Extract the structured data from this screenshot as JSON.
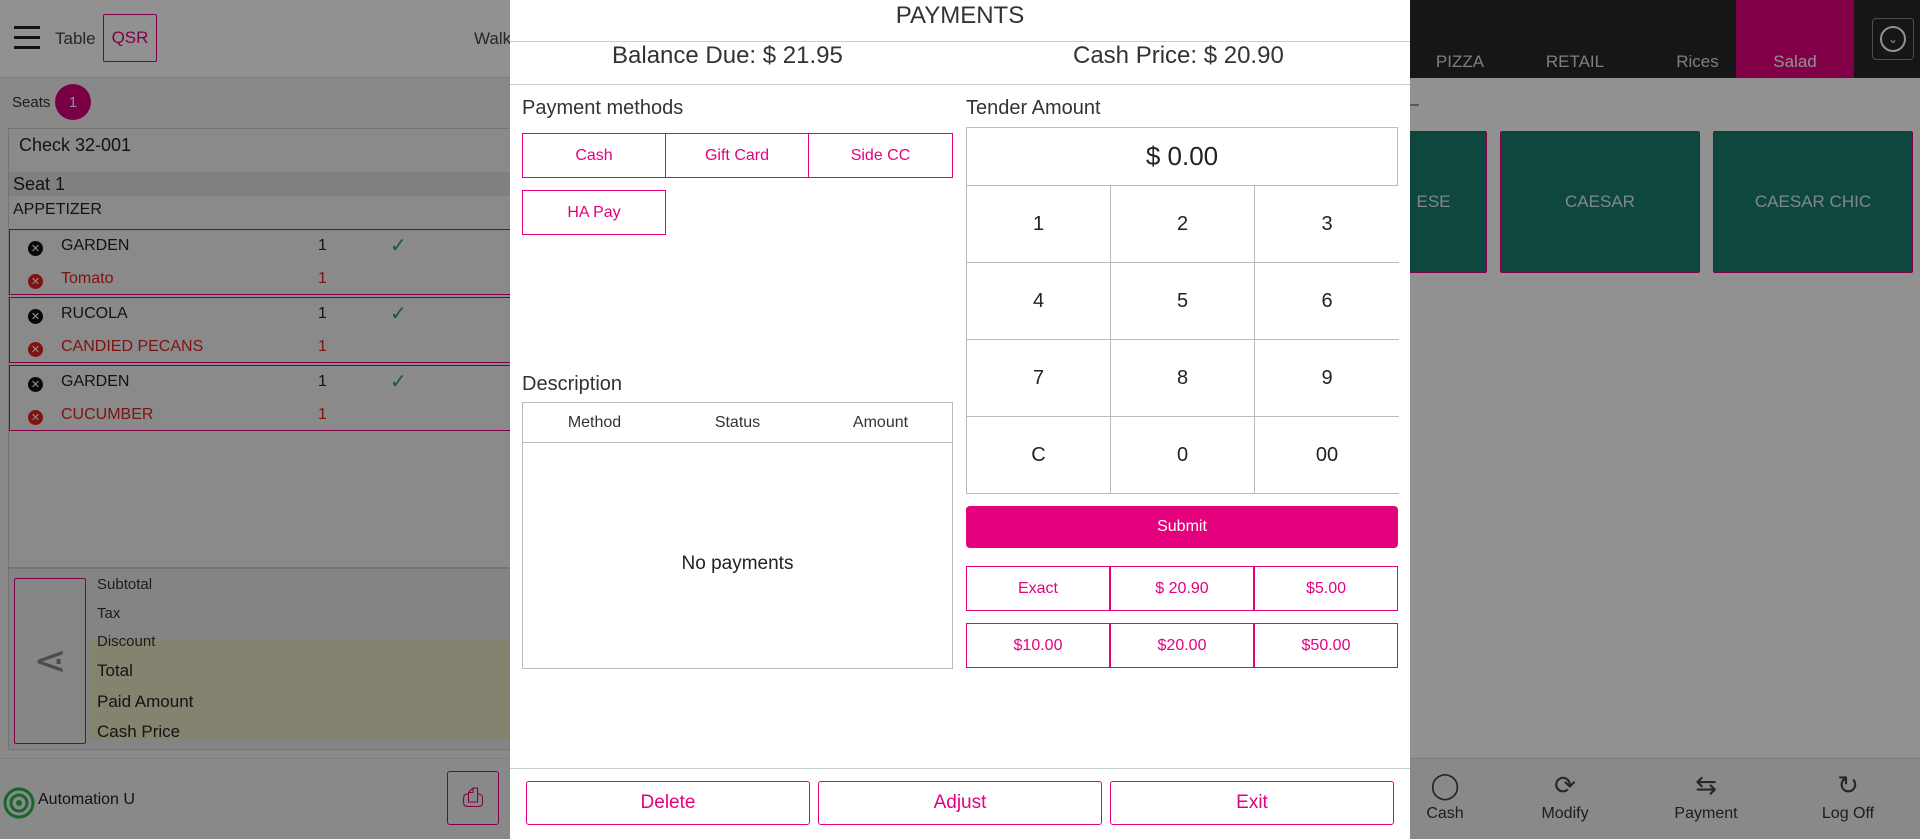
{
  "header": {
    "table_label": "Table",
    "mode_button": "QSR",
    "walk_label": "Walk"
  },
  "categories": {
    "items": [
      {
        "label": "PIZZA"
      },
      {
        "label": "RETAIL"
      },
      {
        "label": "Rices"
      },
      {
        "label": "Salad"
      }
    ],
    "active": "Salad"
  },
  "seats": {
    "label": "Seats",
    "count": "1"
  },
  "check": {
    "title": "Check 32-001",
    "seat_label": "Seat 1",
    "group_label": "APPETIZER",
    "items": [
      {
        "name": "GARDEN",
        "qty": "1",
        "modifier": "Tomato",
        "modifier_qty": "1"
      },
      {
        "name": "RUCOLA",
        "qty": "1",
        "modifier": "CANDIED PECANS",
        "modifier_qty": "1"
      },
      {
        "name": "GARDEN",
        "qty": "1",
        "modifier": "CUCUMBER",
        "modifier_qty": "1"
      }
    ]
  },
  "totals": {
    "subtotal": "Subtotal",
    "tax": "Tax",
    "discount": "Discount",
    "total": "Total",
    "paid": "Paid Amount",
    "cash_price": "Cash Price"
  },
  "menu_tiles": [
    "ESE",
    "CAESAR",
    "CAESAR CHIC"
  ],
  "footer": {
    "user": "Automation U",
    "actions": [
      "Cash",
      "Modify",
      "Payment",
      "Log Off"
    ]
  },
  "modal": {
    "title": "PAYMENTS",
    "balance_due": "Balance Due: $ 21.95",
    "cash_price": "Cash Price: $ 20.90",
    "payment_methods_label": "Payment methods",
    "payment_methods": [
      "Cash",
      "Gift Card",
      "Side CC",
      "HA Pay"
    ],
    "tender_label": "Tender Amount",
    "tender_value": "$ 0.00",
    "keypad": [
      "1",
      "2",
      "3",
      "4",
      "5",
      "6",
      "7",
      "8",
      "9",
      "C",
      "0",
      "00"
    ],
    "submit": "Submit",
    "quick_amounts": [
      "Exact",
      "$ 20.90",
      "$5.00",
      "$10.00",
      "$20.00",
      "$50.00"
    ],
    "description_label": "Description",
    "table_headers": [
      "Method",
      "Status",
      "Amount"
    ],
    "empty_text": "No payments",
    "buttons": {
      "delete": "Delete",
      "adjust": "Adjust",
      "exit": "Exit"
    }
  },
  "colors": {
    "accent": "#e5007e",
    "tile": "#177d6c",
    "category_bar": "#272727"
  }
}
